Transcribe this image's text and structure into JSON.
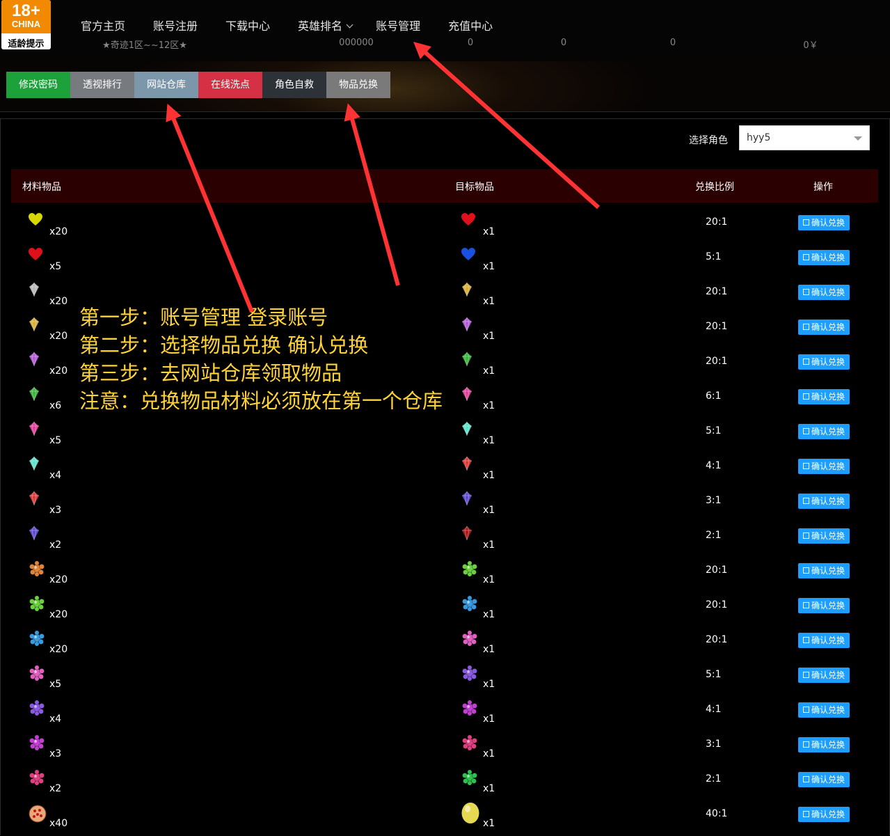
{
  "logo": {
    "big": "18+",
    "country": "CHINA",
    "caption": "适龄提示"
  },
  "nav": {
    "items": [
      {
        "label": "官方主页",
        "dropdown": false
      },
      {
        "label": "账号注册",
        "dropdown": false
      },
      {
        "label": "下载中心",
        "dropdown": false
      },
      {
        "label": "英雄排名",
        "dropdown": true
      },
      {
        "label": "账号管理",
        "dropdown": false
      },
      {
        "label": "充值中心",
        "dropdown": false
      }
    ]
  },
  "stats": [
    "★奇迹1区~~12区★",
    "000000",
    "0",
    "0",
    "0",
    "0￥"
  ],
  "tabs": [
    {
      "label": "修改密码",
      "color": "#1da13a"
    },
    {
      "label": "透视排行",
      "color": "#777b80"
    },
    {
      "label": "网站仓库",
      "color": "#7d97aa"
    },
    {
      "label": "在线洗点",
      "color": "#d63045"
    },
    {
      "label": "角色自救",
      "color": "#2d3238"
    },
    {
      "label": "物品兑换",
      "color": "#7a7a7a"
    }
  ],
  "role": {
    "label": "选择角色",
    "value": "hyy5"
  },
  "table": {
    "headers": {
      "material": "材料物品",
      "target": "目标物品",
      "ratio": "兑换比例",
      "action": "操作"
    },
    "button_label": "确认兑换",
    "rows": [
      {
        "mat_icon": "yellow-heart-icon",
        "mat_qty": "x20",
        "tgt_icon": "red-heart-icon",
        "tgt_qty": "x1",
        "ratio": "20:1"
      },
      {
        "mat_icon": "red-heart-icon",
        "mat_qty": "x5",
        "tgt_icon": "blue-heart-icon",
        "tgt_qty": "x1",
        "ratio": "5:1"
      },
      {
        "mat_icon": "silver-jewel-icon",
        "mat_qty": "x20",
        "tgt_icon": "gold-jewel-icon",
        "tgt_qty": "x1",
        "ratio": "20:1"
      },
      {
        "mat_icon": "gold-jewel-icon",
        "mat_qty": "x20",
        "tgt_icon": "purple-jewel-icon",
        "tgt_qty": "x1",
        "ratio": "20:1"
      },
      {
        "mat_icon": "purple-jewel-icon",
        "mat_qty": "x20",
        "tgt_icon": "green-jewel-icon",
        "tgt_qty": "x1",
        "ratio": "20:1"
      },
      {
        "mat_icon": "green-jewel-icon",
        "mat_qty": "x6",
        "tgt_icon": "pink-jewel-icon",
        "tgt_qty": "x1",
        "ratio": "6:1"
      },
      {
        "mat_icon": "pink-jewel-icon",
        "mat_qty": "x5",
        "tgt_icon": "cyan-jewel-icon",
        "tgt_qty": "x1",
        "ratio": "5:1"
      },
      {
        "mat_icon": "cyan-jewel-icon",
        "mat_qty": "x4",
        "tgt_icon": "red-jewel-icon",
        "tgt_qty": "x1",
        "ratio": "4:1"
      },
      {
        "mat_icon": "red-jewel-icon",
        "mat_qty": "x3",
        "tgt_icon": "indigo-jewel-icon",
        "tgt_qty": "x1",
        "ratio": "3:1"
      },
      {
        "mat_icon": "indigo-jewel-icon",
        "mat_qty": "x2",
        "tgt_icon": "crimson-jewel-icon",
        "tgt_qty": "x1",
        "ratio": "2:1"
      },
      {
        "mat_icon": "orange-gem-cluster-icon",
        "mat_qty": "x20",
        "tgt_icon": "green-gem-cluster-icon",
        "tgt_qty": "x1",
        "ratio": "20:1"
      },
      {
        "mat_icon": "green-gem-cluster-icon",
        "mat_qty": "x20",
        "tgt_icon": "blue-gem-cluster-icon",
        "tgt_qty": "x1",
        "ratio": "20:1"
      },
      {
        "mat_icon": "blue-gem-cluster-icon",
        "mat_qty": "x20",
        "tgt_icon": "pink-gem-cluster-icon",
        "tgt_qty": "x1",
        "ratio": "20:1"
      },
      {
        "mat_icon": "pink-gem-cluster-icon",
        "mat_qty": "x5",
        "tgt_icon": "violet-gem-cluster-icon",
        "tgt_qty": "x1",
        "ratio": "5:1"
      },
      {
        "mat_icon": "violet-gem-cluster-icon",
        "mat_qty": "x4",
        "tgt_icon": "magenta-gem-cluster-icon",
        "tgt_qty": "x1",
        "ratio": "4:1"
      },
      {
        "mat_icon": "magenta-gem-cluster-icon",
        "mat_qty": "x3",
        "tgt_icon": "rose-gem-cluster-icon",
        "tgt_qty": "x1",
        "ratio": "3:1"
      },
      {
        "mat_icon": "rose-gem-cluster-icon",
        "mat_qty": "x2",
        "tgt_icon": "emerald-gem-cluster-icon",
        "tgt_qty": "x1",
        "ratio": "2:1"
      },
      {
        "mat_icon": "pizza-orb-icon",
        "mat_qty": "x40",
        "tgt_icon": "golden-egg-icon",
        "tgt_qty": "x1",
        "ratio": "40:1"
      }
    ]
  },
  "annotation": {
    "lines": [
      "第一步：账号管理 登录账号",
      "第二步：选择物品兑换 确认兑换",
      "第三步：去网站仓库领取物品",
      "注意：兑换物品材料必须放在第一个仓库"
    ],
    "color": "#ffd23a",
    "arrow_color": "#ff3333"
  }
}
